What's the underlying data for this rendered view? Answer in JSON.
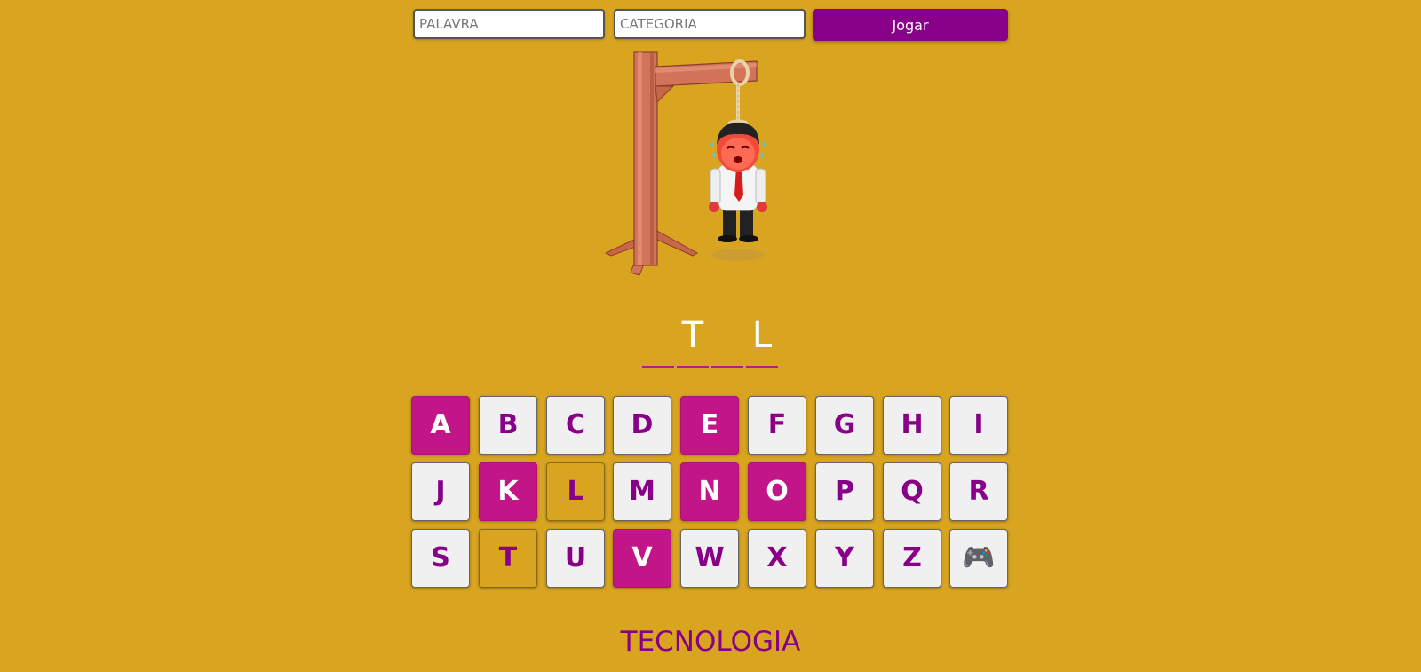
{
  "inputs": {
    "word_placeholder": "PALAVRA",
    "category_placeholder": "CATEGORIA"
  },
  "play_button": {
    "label": "Jogar"
  },
  "word_slots": [
    "",
    "T",
    "",
    "L"
  ],
  "keyboard": {
    "rows": [
      [
        {
          "label": "A",
          "state": "wrong"
        },
        {
          "label": "B",
          "state": "unused"
        },
        {
          "label": "C",
          "state": "unused"
        },
        {
          "label": "D",
          "state": "unused"
        },
        {
          "label": "E",
          "state": "wrong"
        },
        {
          "label": "F",
          "state": "unused"
        },
        {
          "label": "G",
          "state": "unused"
        },
        {
          "label": "H",
          "state": "unused"
        },
        {
          "label": "I",
          "state": "unused"
        }
      ],
      [
        {
          "label": "J",
          "state": "unused"
        },
        {
          "label": "K",
          "state": "wrong"
        },
        {
          "label": "L",
          "state": "right"
        },
        {
          "label": "M",
          "state": "unused"
        },
        {
          "label": "N",
          "state": "wrong"
        },
        {
          "label": "O",
          "state": "wrong"
        },
        {
          "label": "P",
          "state": "unused"
        },
        {
          "label": "Q",
          "state": "unused"
        },
        {
          "label": "R",
          "state": "unused"
        }
      ],
      [
        {
          "label": "S",
          "state": "unused"
        },
        {
          "label": "T",
          "state": "right"
        },
        {
          "label": "U",
          "state": "unused"
        },
        {
          "label": "V",
          "state": "wrong"
        },
        {
          "label": "W",
          "state": "unused"
        },
        {
          "label": "X",
          "state": "unused"
        },
        {
          "label": "Y",
          "state": "unused"
        },
        {
          "label": "Z",
          "state": "unused"
        },
        {
          "label": "🎮",
          "state": "unused",
          "icon": "gamepad-icon"
        }
      ]
    ]
  },
  "category_text": "TECNOLOGIA",
  "colors": {
    "background": "#d9a520",
    "accent_purple": "#880088",
    "wrong_key": "#c21587",
    "key_default": "#f0f0f0"
  },
  "hangman": {
    "stage": "head-body-arms-legs",
    "figure_icon": "hanged-man-icon",
    "gallows_icon": "gallows-icon"
  }
}
